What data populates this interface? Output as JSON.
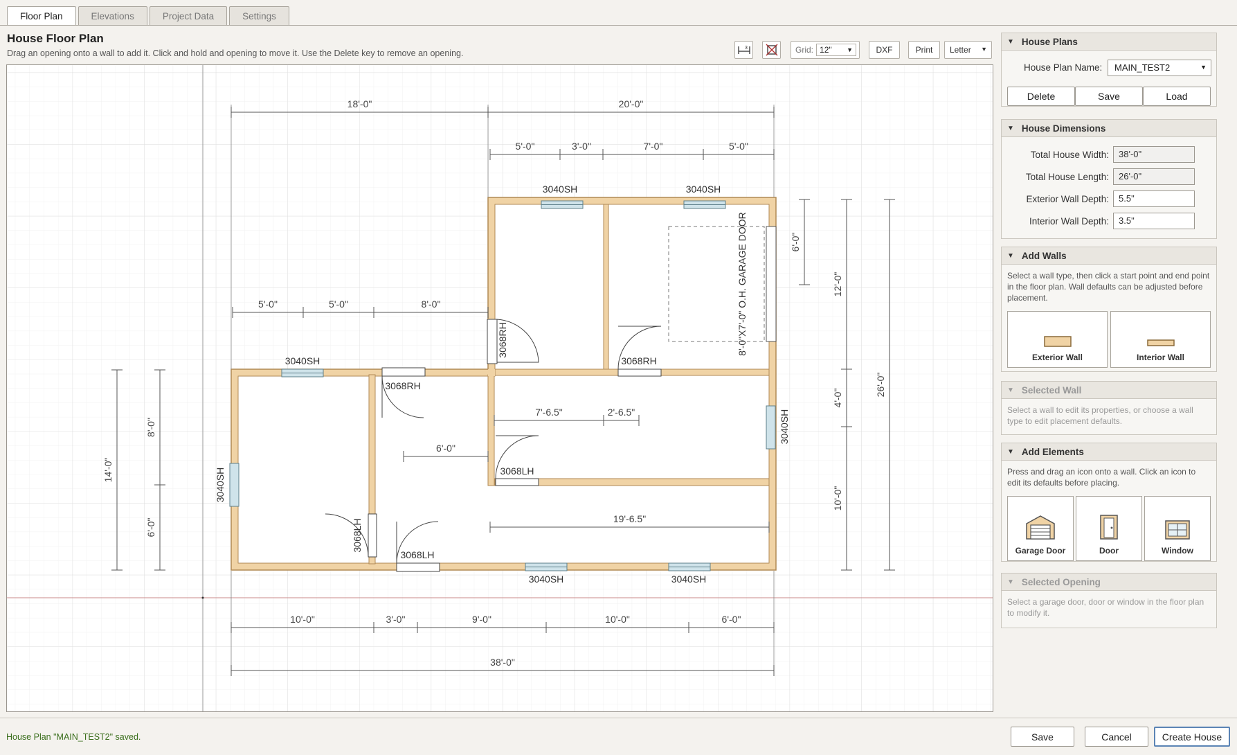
{
  "tabs": [
    "Floor Plan",
    "Elevations",
    "Project Data",
    "Settings"
  ],
  "page": {
    "title": "House Floor Plan",
    "subtitle": "Drag an opening onto a wall to add it. Click and hold and opening to move it. Use the Delete key to remove an opening."
  },
  "toolbar": {
    "dim_icon": "dimension-icon",
    "fit_icon": "fit-to-view-icon",
    "grid_label": "Grid:",
    "grid_value": "12\"",
    "dxf_label": "DXF",
    "print_label": "Print",
    "paper_value": "Letter"
  },
  "plan": {
    "top_dims": [
      "18'-0\"",
      "20'-0\""
    ],
    "top_sub_dims": [
      "5'-0\"",
      "3'-0\"",
      "7'-0\"",
      "5'-0\""
    ],
    "mid_dims": [
      "5'-0\"",
      "5'-0\"",
      "8'-0\""
    ],
    "bottom_dims": [
      "10'-0\"",
      "3'-0\"",
      "9'-0\"",
      "10'-0\"",
      "6'-0\""
    ],
    "overall_width": "38'-0\"",
    "right_dims": [
      "6'-0\"",
      "12'-0\"",
      "4'-0\"",
      "10'-0\"",
      "26'-0\""
    ],
    "left_dims": [
      "8'-0\"",
      "6'-0\"",
      "14'-0\""
    ],
    "inner_dims": [
      "7'-6.5\"",
      "2'-6.5\"",
      "6'-0\"",
      "19'-6.5\""
    ],
    "windows": [
      "3040SH",
      "3040SH",
      "3040SH",
      "3040SH",
      "3040SH",
      "3040SH",
      "3040SH"
    ],
    "doors": [
      "3068RH",
      "3068RH",
      "3068RH",
      "3068LH",
      "3068LH",
      "3068LH"
    ],
    "garage_door": "8'-0\"X7'-0\" O.H. GARAGE DOOR"
  },
  "house_plans": {
    "header": "House Plans",
    "name_label": "House Plan Name:",
    "name_value": "MAIN_TEST2",
    "delete_label": "Delete",
    "save_label": "Save",
    "load_label": "Load"
  },
  "house_dimensions": {
    "header": "House Dimensions",
    "fields": [
      {
        "label": "Total House Width:",
        "value": "38'-0\""
      },
      {
        "label": "Total House Length:",
        "value": "26'-0\""
      },
      {
        "label": "Exterior Wall Depth:",
        "value": "5.5\""
      },
      {
        "label": "Interior Wall Depth:",
        "value": "3.5\""
      }
    ]
  },
  "add_walls": {
    "header": "Add Walls",
    "text": "Select a wall type, then click a start point and end point in the floor plan. Wall defaults can be adjusted before placement.",
    "exterior_label": "Exterior Wall",
    "interior_label": "Interior Wall"
  },
  "selected_wall": {
    "header": "Selected Wall",
    "text": "Select a wall to edit its properties, or choose a wall type to edit placement defaults."
  },
  "add_elements": {
    "header": "Add Elements",
    "text": "Press and drag an icon onto a wall. Click an icon to edit its defaults before placing.",
    "garage_label": "Garage Door",
    "door_label": "Door",
    "window_label": "Window"
  },
  "selected_opening": {
    "header": "Selected Opening",
    "text": "Select a garage door, door or window in the floor plan to modify it."
  },
  "footer": {
    "status": "House Plan \"MAIN_TEST2\" saved.",
    "save_label": "Save",
    "cancel_label": "Cancel",
    "create_label": "Create House"
  },
  "colors": {
    "wall_fill": "#f0d3a5",
    "wall_stroke": "#b08a55",
    "window_fill": "#cfe3ea",
    "grid_major": "#e2e2e2",
    "grid_minor": "#f2f2f2",
    "status_green": "#3a6e1c",
    "primary_border": "#5b84b5"
  }
}
